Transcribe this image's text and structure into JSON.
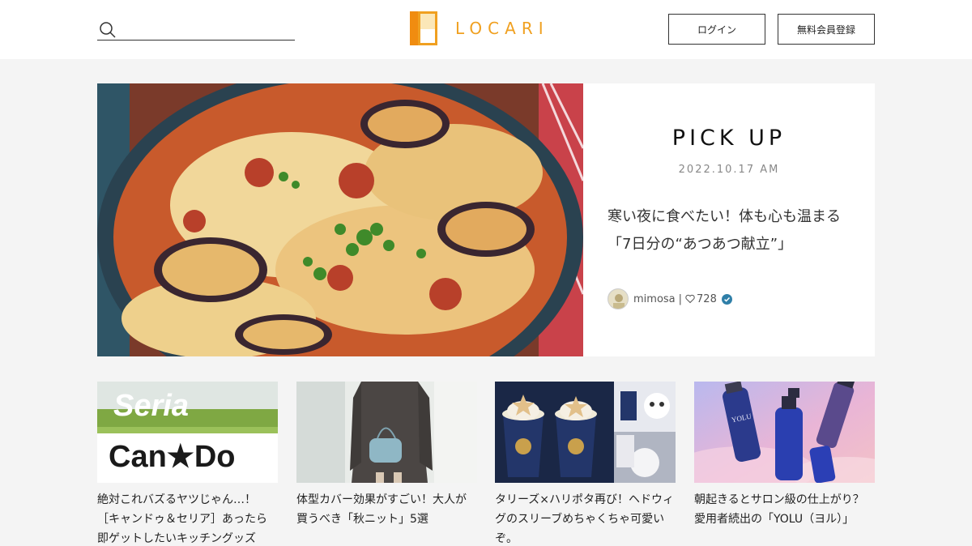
{
  "header": {
    "search_placeholder": "",
    "logo_text": "LOCARI",
    "login_label": "ログイン",
    "register_label": "無料会員登録",
    "brand_color": "#f0a020"
  },
  "pickup": {
    "title": "PICK UP",
    "date": "2022.10.17 AM",
    "headline": "寒い夜に食べたい！体も心も温まる「7日分の“あつあつ献立”」",
    "author": "mimosa",
    "separator": "|",
    "likes": "728",
    "image_icon": "food-photo"
  },
  "cards": [
    {
      "title": "絶対これバズるヤツじゃん…！［キャンドゥ＆セリア］あったら即ゲットしたいキッチングッズ",
      "image_text_top": "Seria",
      "image_text_bottom": "Can★Do"
    },
    {
      "title": "体型カバー効果がすごい！大人が買うべき「秋ニット」5選"
    },
    {
      "title": "タリーズ×ハリポタ再び！ヘドウィグのスリーブめちゃくちゃ可愛いぞ。"
    },
    {
      "title": "朝起きるとサロン級の仕上がり？　愛用者続出の「YOLU（ヨル）」",
      "image_text": "YOLU"
    }
  ]
}
